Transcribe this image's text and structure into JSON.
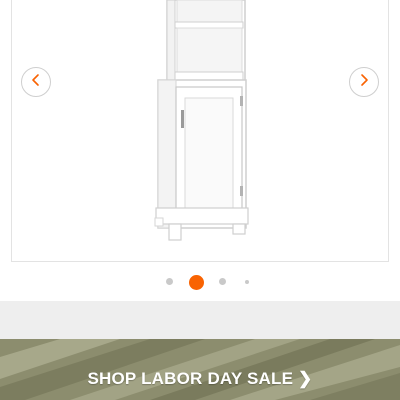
{
  "carousel": {
    "prev_icon": "chevron-left-icon",
    "next_icon": "chevron-right-icon",
    "image_count": 4,
    "active_index": 1
  },
  "promo": {
    "label": "SHOP LABOR DAY SALE ❯",
    "accent_color": "#f96302"
  }
}
